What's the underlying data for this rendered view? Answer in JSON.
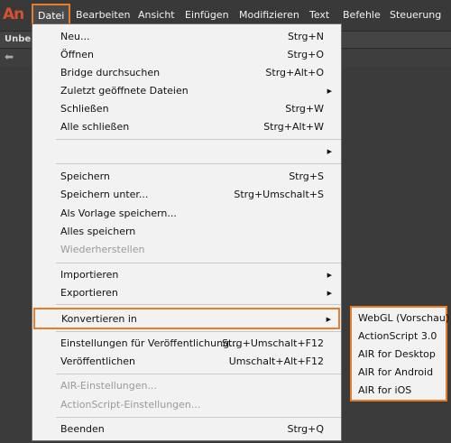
{
  "app": {
    "logo": "An"
  },
  "menubar": {
    "items": [
      "Datei",
      "Bearbeiten",
      "Ansicht",
      "Einfügen",
      "Modifizieren",
      "Text",
      "Befehle",
      "Steuerung"
    ]
  },
  "docbar": {
    "tab_label": "Unbe"
  },
  "file_menu": {
    "items": [
      {
        "label": "Neu...",
        "shortcut": "Strg+N"
      },
      {
        "label": "Öffnen",
        "shortcut": "Strg+O"
      },
      {
        "label": "Bridge durchsuchen",
        "shortcut": "Strg+Alt+O"
      },
      {
        "label": "Zuletzt geöffnete Dateien",
        "shortcut": ""
      },
      {
        "label": "Schließen",
        "shortcut": "Strg+W"
      },
      {
        "label": "Alle schließen",
        "shortcut": "Strg+Alt+W"
      },
      {
        "label": "",
        "shortcut": ""
      },
      {
        "label": "Speichern",
        "shortcut": "Strg+S"
      },
      {
        "label": "Speichern unter...",
        "shortcut": "Strg+Umschalt+S"
      },
      {
        "label": "Als Vorlage speichern...",
        "shortcut": ""
      },
      {
        "label": "Alles speichern",
        "shortcut": ""
      },
      {
        "label": "Wiederherstellen",
        "shortcut": ""
      },
      {
        "label": "Importieren",
        "shortcut": ""
      },
      {
        "label": "Exportieren",
        "shortcut": ""
      },
      {
        "label": "Konvertieren in",
        "shortcut": ""
      },
      {
        "label": "Einstellungen für Veröffentlichung...",
        "shortcut": "Strg+Umschalt+F12"
      },
      {
        "label": "Veröffentlichen",
        "shortcut": "Umschalt+Alt+F12"
      },
      {
        "label": "AIR-Einstellungen...",
        "shortcut": ""
      },
      {
        "label": "ActionScript-Einstellungen...",
        "shortcut": ""
      },
      {
        "label": "Beenden",
        "shortcut": "Strg+Q"
      }
    ],
    "submenu_arrow": "▶"
  },
  "convert_submenu": {
    "items": [
      "WebGL (Vorschau)",
      "ActionScript 3.0",
      "AIR for Desktop",
      "AIR for Android",
      "AIR for iOS"
    ]
  },
  "colors": {
    "highlight_border": "#e57d2a",
    "menu_bg": "#f2f2f2",
    "app_bg": "#3b3b3b",
    "logo": "#d4522d"
  }
}
